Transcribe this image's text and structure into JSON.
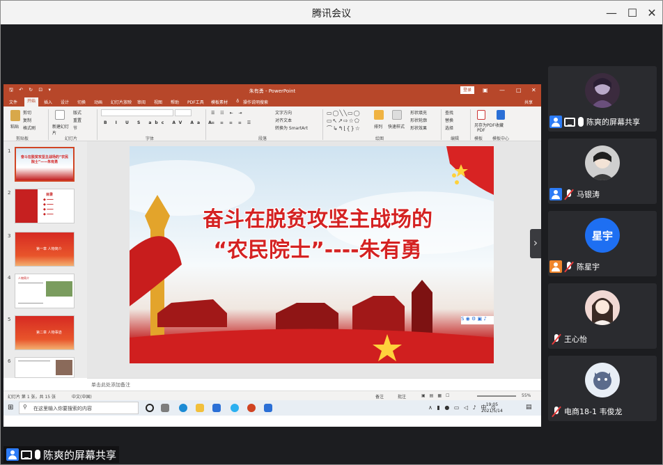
{
  "app": {
    "title": "腾讯会议"
  },
  "window_controls": {
    "minimize": "—",
    "maximize": "☐",
    "close": "✕"
  },
  "share": {
    "label": "陈爽的屏幕共享",
    "ppt": {
      "doc_title": "朱有勇 - PowerPoint",
      "signin": "登录",
      "share_btn": "共享",
      "tabs": [
        "文件",
        "开始",
        "插入",
        "设计",
        "切换",
        "动画",
        "幻灯片放映",
        "审阅",
        "视图",
        "帮助",
        "PDF工具",
        "模板素材",
        "操作说明搜索"
      ],
      "ribbon_groups": [
        "剪贴板",
        "幻灯片",
        "字体",
        "段落",
        "绘图",
        "编辑",
        "模板",
        "模板中心"
      ],
      "ribbon_buttons": {
        "paste": "粘贴",
        "cut": "剪切",
        "copy": "复制",
        "format_painter": "格式刷",
        "new_slide": "新建幻灯片",
        "layout": "版式",
        "reset": "重置",
        "section": "节",
        "text_direction": "文字方向",
        "align_text": "对齐文本",
        "smartart": "转换为 SmartArt",
        "arrange": "排列",
        "quick_styles": "快速样式",
        "shape_fill": "形状填充",
        "shape_outline": "形状轮廓",
        "shape_effects": "形状效果",
        "find": "查找",
        "replace": "替换",
        "select": "选择",
        "save_pdf": "另存为PDF",
        "pdf_label": "PDF",
        "collect": "收藏"
      },
      "slide": {
        "title_line1": "奋斗在脱贫攻坚主战场的",
        "title_line2": "“农民院士”----朱有勇"
      },
      "thumbnails": [
        {
          "num": "1",
          "caption": "奋斗在脱贫攻坚主战场的“农民院士”——朱有勇"
        },
        {
          "num": "2",
          "caption": "目录"
        },
        {
          "num": "3",
          "caption": "第一章 人物简介"
        },
        {
          "num": "4",
          "caption": "人物简介"
        },
        {
          "num": "5",
          "caption": "第二章 人物事迹"
        },
        {
          "num": "6",
          "caption": ""
        }
      ],
      "notes_placeholder": "单击此处添加备注",
      "status": {
        "slide_count": "幻灯片 第 1 张，共 15 张",
        "language": "中文(中国)",
        "notes": "备注",
        "comments": "批注",
        "zoom": "55%"
      }
    },
    "taskbar": {
      "search_placeholder": "在这里输入你要搜索的内容",
      "time": "19:05",
      "date": "2021/5/14"
    }
  },
  "participants": [
    {
      "name": "陈爽的屏幕共享",
      "avatar_text": "",
      "avatar_color": "#3b2b3e",
      "role": "sharing",
      "badge_color": "#2d7cf6"
    },
    {
      "name": "马银涛",
      "avatar_text": "",
      "avatar_color": "#cfcfcf",
      "role": "muted",
      "badge_color": "#2d7cf6"
    },
    {
      "name": "陈星宇",
      "avatar_text": "星宇",
      "avatar_color": "#1e6ff2",
      "role": "muted",
      "badge_color": "#f0852b"
    },
    {
      "name": "王心怡",
      "avatar_text": "",
      "avatar_color": "#f1d8d3",
      "role": "muted",
      "badge_color": ""
    },
    {
      "name": "电商18-1 韦俊龙",
      "avatar_text": "",
      "avatar_color": "#e8eef6",
      "role": "muted",
      "badge_color": ""
    }
  ]
}
